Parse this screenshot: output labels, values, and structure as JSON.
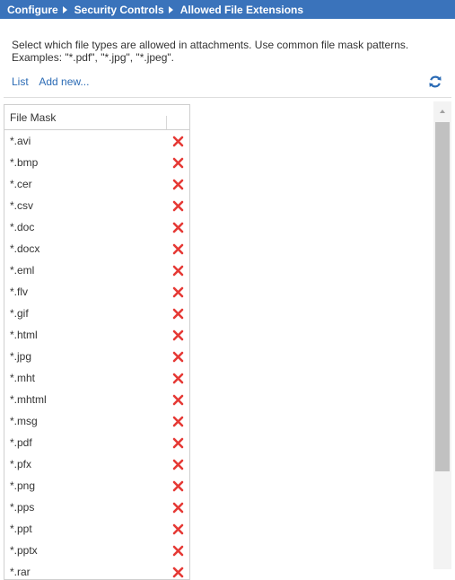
{
  "breadcrumb": {
    "items": [
      "Configure",
      "Security Controls",
      "Allowed File Extensions"
    ]
  },
  "description": "Select which file types are allowed in attachments. Use common file mask patterns. Examples: \"*.pdf\", \"*.jpg\", \"*.jpeg\".",
  "links": {
    "list": "List",
    "add_new": "Add new..."
  },
  "icons": {
    "refresh": "refresh-icon",
    "delete": "delete-x-icon"
  },
  "colors": {
    "header_bg": "#3a73bb",
    "link": "#2b6bb5",
    "delete": "#e53935"
  },
  "grid": {
    "column_header": "File Mask",
    "rows": [
      "*.avi",
      "*.bmp",
      "*.cer",
      "*.csv",
      "*.doc",
      "*.docx",
      "*.eml",
      "*.flv",
      "*.gif",
      "*.html",
      "*.jpg",
      "*.mht",
      "*.mhtml",
      "*.msg",
      "*.pdf",
      "*.pfx",
      "*.png",
      "*.pps",
      "*.ppt",
      "*.pptx",
      "*.rar"
    ]
  }
}
